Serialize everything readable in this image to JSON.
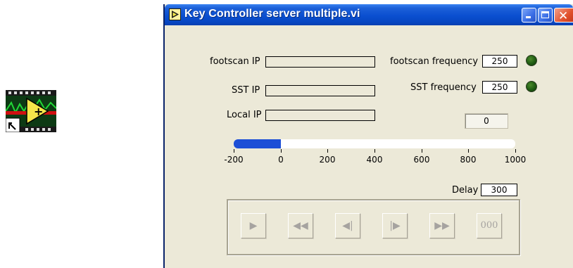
{
  "window": {
    "title": "Key Controller server multiple.vi"
  },
  "panel": {
    "footscan_ip_label": "footscan IP",
    "footscan_ip_value": "",
    "sst_ip_label": "SST IP",
    "sst_ip_value": "",
    "local_ip_label": "Local IP",
    "local_ip_value": "",
    "footscan_freq_label": "footscan frequency",
    "footscan_freq_value": "250",
    "sst_freq_label": "SST frequency",
    "sst_freq_value": "250",
    "counter_value": "0",
    "slider": {
      "min": -200,
      "max": 1000,
      "value": 0,
      "tick_labels": [
        "-200",
        "0",
        "200",
        "400",
        "600",
        "800",
        "1000"
      ]
    },
    "delay_label": "Delay",
    "delay_value": "300"
  },
  "transport": {
    "buttons": [
      {
        "name": "play",
        "glyph": "▶"
      },
      {
        "name": "rewind",
        "glyph": "◀◀"
      },
      {
        "name": "step-back",
        "glyph": "◀|"
      },
      {
        "name": "step-forward",
        "glyph": "|▶"
      },
      {
        "name": "fast-forward",
        "glyph": "▶▶"
      },
      {
        "name": "reset",
        "glyph": "000"
      }
    ]
  },
  "colors": {
    "titlebar": "#0a4fd0",
    "window_bg": "#ece9d8",
    "slider_fill": "#1d4fd6",
    "led": "#1f5a12"
  }
}
